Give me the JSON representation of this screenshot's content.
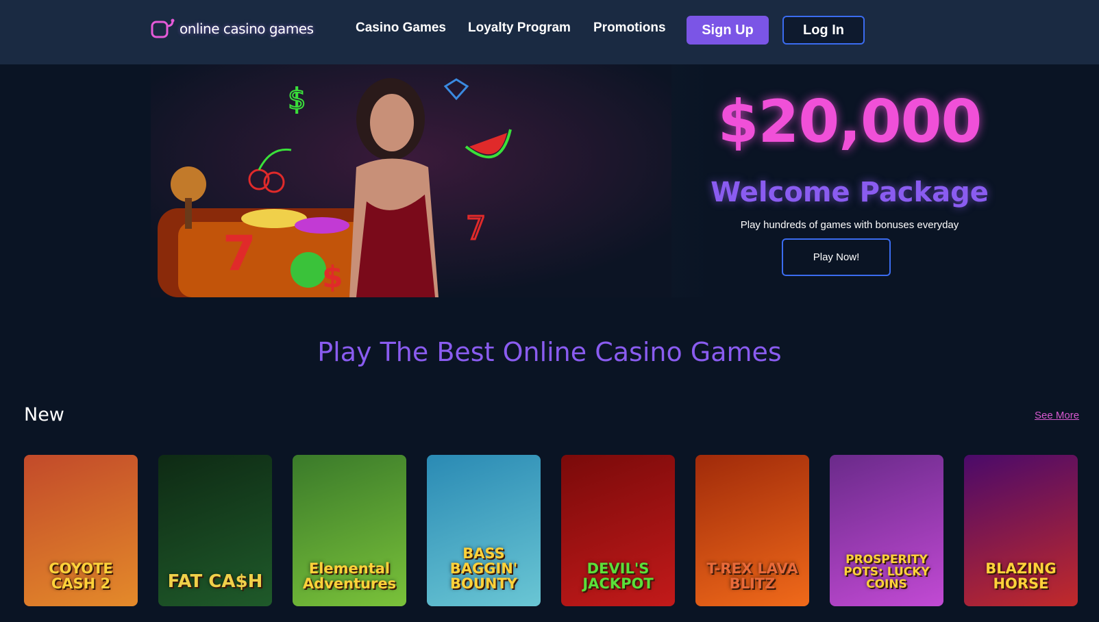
{
  "brand": {
    "name": "online casino games"
  },
  "nav": {
    "items": [
      {
        "label": "Casino Games"
      },
      {
        "label": "Loyalty Program"
      },
      {
        "label": "Promotions"
      }
    ],
    "signup_label": "Sign Up",
    "login_label": "Log In"
  },
  "hero": {
    "amount": "$20,000",
    "subtitle": "Welcome Package",
    "description": "Play hundreds of games with bonuses everyday",
    "cta": "Play Now!"
  },
  "section": {
    "title": "Play The Best Online Casino Games"
  },
  "new_row": {
    "title": "New",
    "see_more": "See More",
    "games": [
      {
        "title": "COYOTE CASH 2",
        "colors": [
          "#c24a2a",
          "#e48a2a"
        ],
        "text_color": "#ffd23a"
      },
      {
        "title": "FAT CA$H",
        "colors": [
          "#0e2a14",
          "#1f5a2a"
        ],
        "text_color": "#f0d04a"
      },
      {
        "title": "Elemental Adventures",
        "colors": [
          "#3a7a2a",
          "#7ac23a"
        ],
        "text_color": "#ffd23a"
      },
      {
        "title": "BASS BAGGIN' BOUNTY",
        "colors": [
          "#2a8ab4",
          "#6ac6d4"
        ],
        "text_color": "#ffd23a"
      },
      {
        "title": "DEVIL'S JACKPOT",
        "colors": [
          "#7a0a0a",
          "#c21a1a"
        ],
        "text_color": "#5ae03a"
      },
      {
        "title": "T-REX LAVA BLITZ",
        "colors": [
          "#a02a0a",
          "#f06a1a"
        ],
        "text_color": "#e86a3a"
      },
      {
        "title": "PROSPERITY POTS: LUCKY COINS",
        "colors": [
          "#6a2a8a",
          "#c24ad4"
        ],
        "text_color": "#ffd23a"
      },
      {
        "title": "BLAZING HORSE",
        "colors": [
          "#4a0a6a",
          "#c22a2a"
        ],
        "text_color": "#ffd23a"
      }
    ]
  }
}
